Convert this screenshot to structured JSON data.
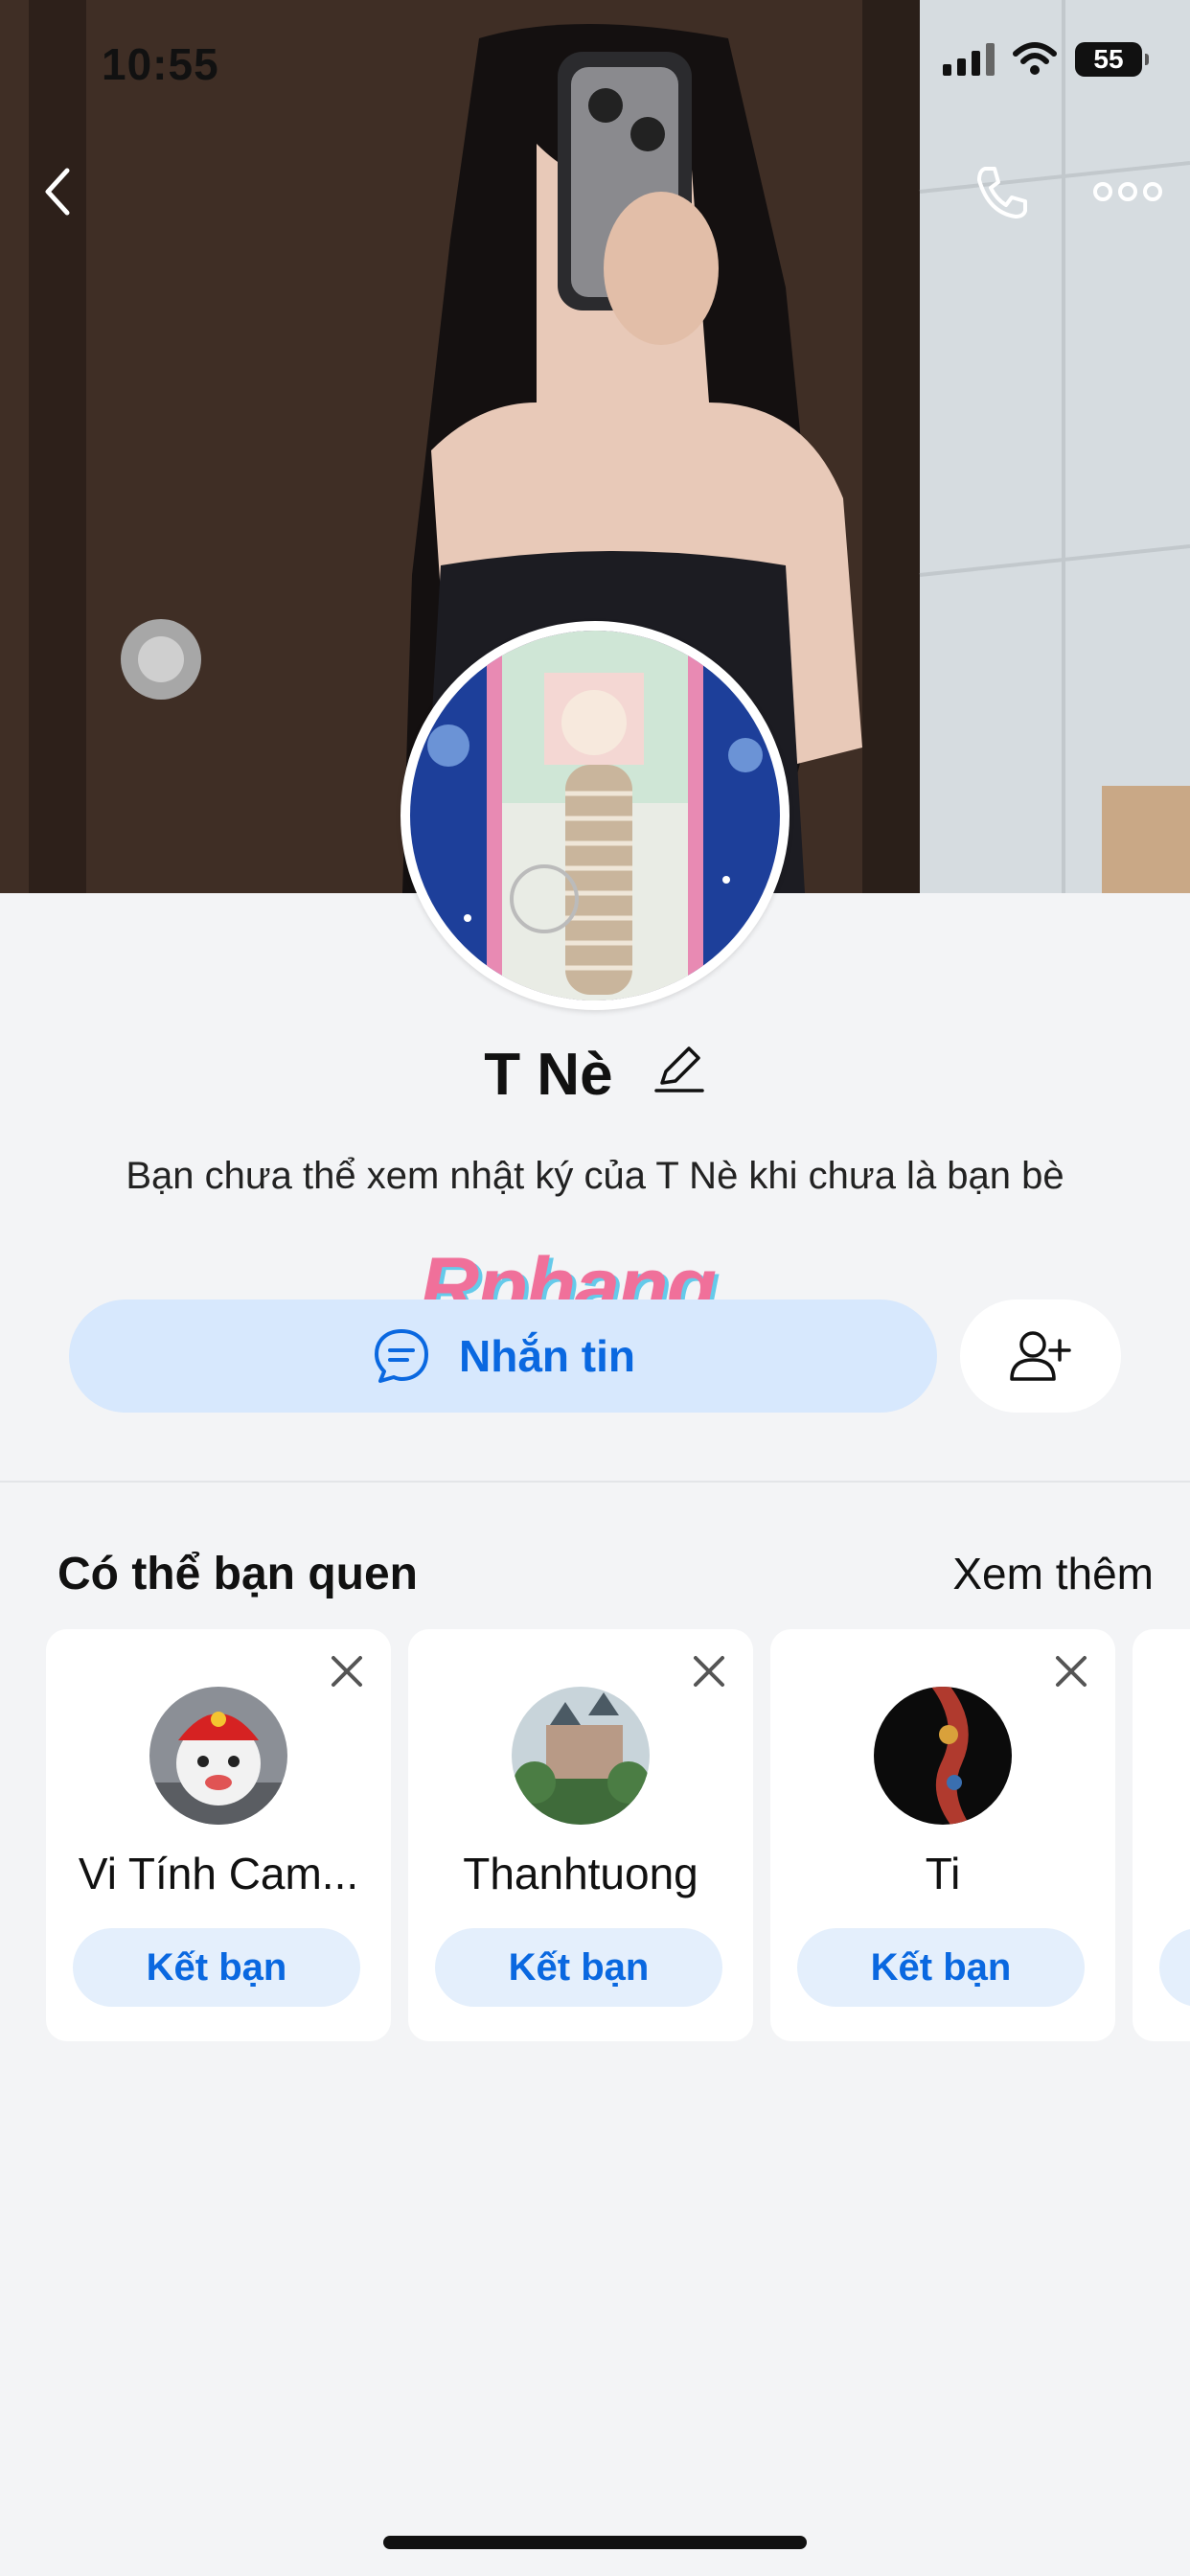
{
  "status_bar": {
    "time": "10:55",
    "battery": "55"
  },
  "profile": {
    "name": "T Nè",
    "notice": "Bạn chưa thể xem nhật ký của T Nè khi chưa là bạn bè"
  },
  "watermark": "Rphang",
  "actions": {
    "message_label": "Nhắn tin"
  },
  "suggestions": {
    "title": "Có thể bạn quen",
    "see_more": "Xem thêm",
    "items": [
      {
        "name": "Vi Tính  Cam...",
        "button": "Kết bạn"
      },
      {
        "name": "Thanhtuong",
        "button": "Kết bạn"
      },
      {
        "name": "Ti",
        "button": "Kết bạn"
      }
    ]
  },
  "icons": {
    "back": "chevron-left-icon",
    "call": "phone-icon",
    "more": "more-dots-icon",
    "edit": "pencil-icon",
    "message": "chat-bubble-icon",
    "add_friend": "add-person-icon",
    "close": "close-icon"
  },
  "colors": {
    "accent": "#0a68e0",
    "accent_light": "#d7e8fd",
    "background": "#f3f4f6"
  }
}
